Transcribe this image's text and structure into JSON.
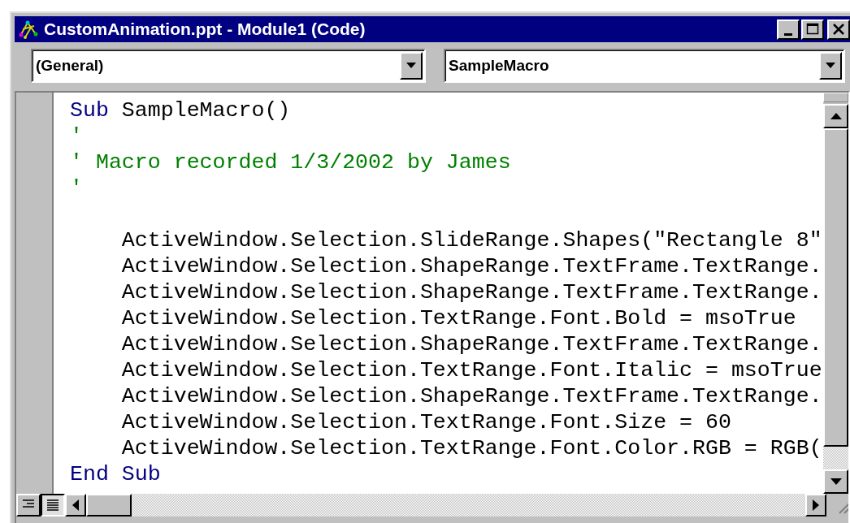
{
  "window": {
    "title": "CustomAnimation.ppt - Module1 (Code)"
  },
  "object_combo": {
    "value": "(General)"
  },
  "procedure_combo": {
    "value": "SampleMacro"
  },
  "code_lines": [
    {
      "kind": "code",
      "tokens": [
        {
          "kind": "keyword",
          "text": "Sub"
        },
        {
          "kind": "plain",
          "text": " SampleMacro()"
        }
      ]
    },
    {
      "kind": "code",
      "tokens": [
        {
          "kind": "comment",
          "text": "'"
        }
      ]
    },
    {
      "kind": "code",
      "tokens": [
        {
          "kind": "comment",
          "text": "' Macro recorded 1/3/2002 by James"
        }
      ]
    },
    {
      "kind": "code",
      "tokens": [
        {
          "kind": "comment",
          "text": "'"
        }
      ]
    },
    {
      "kind": "blank"
    },
    {
      "kind": "code",
      "tokens": [
        {
          "kind": "plain",
          "text": "    ActiveWindow.Selection.SlideRange.Shapes(\"Rectangle 8\""
        }
      ]
    },
    {
      "kind": "code",
      "tokens": [
        {
          "kind": "plain",
          "text": "    ActiveWindow.Selection.ShapeRange.TextFrame.TextRange."
        }
      ]
    },
    {
      "kind": "code",
      "tokens": [
        {
          "kind": "plain",
          "text": "    ActiveWindow.Selection.ShapeRange.TextFrame.TextRange."
        }
      ]
    },
    {
      "kind": "code",
      "tokens": [
        {
          "kind": "plain",
          "text": "    ActiveWindow.Selection.TextRange.Font.Bold = msoTrue"
        }
      ]
    },
    {
      "kind": "code",
      "tokens": [
        {
          "kind": "plain",
          "text": "    ActiveWindow.Selection.ShapeRange.TextFrame.TextRange."
        }
      ]
    },
    {
      "kind": "code",
      "tokens": [
        {
          "kind": "plain",
          "text": "    ActiveWindow.Selection.TextRange.Font.Italic = msoTrue"
        }
      ]
    },
    {
      "kind": "code",
      "tokens": [
        {
          "kind": "plain",
          "text": "    ActiveWindow.Selection.ShapeRange.TextFrame.TextRange."
        }
      ]
    },
    {
      "kind": "code",
      "tokens": [
        {
          "kind": "plain",
          "text": "    ActiveWindow.Selection.TextRange.Font.Size = 60"
        }
      ]
    },
    {
      "kind": "code",
      "tokens": [
        {
          "kind": "plain",
          "text": "    ActiveWindow.Selection.TextRange.Font.Color.RGB = RGB("
        }
      ]
    },
    {
      "kind": "code",
      "tokens": [
        {
          "kind": "keyword",
          "text": "End Sub"
        }
      ]
    }
  ],
  "view_buttons": [
    {
      "selected": false
    },
    {
      "selected": true
    }
  ]
}
